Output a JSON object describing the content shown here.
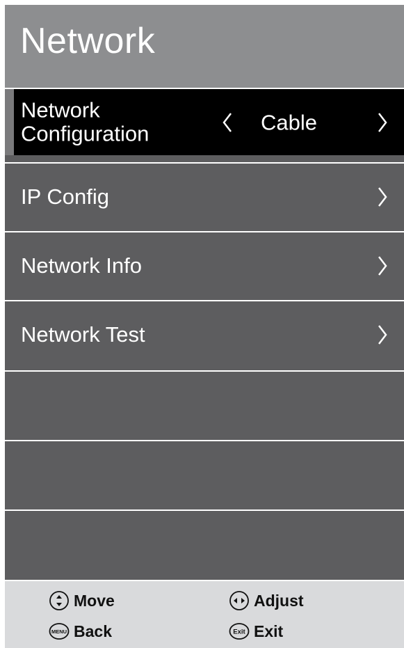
{
  "header": {
    "title": "Network"
  },
  "menu": {
    "items": [
      {
        "label": "Network Configuration",
        "value": "Cable",
        "selected": true
      },
      {
        "label": "IP Config"
      },
      {
        "label": "Network Info"
      },
      {
        "label": "Network Test"
      }
    ]
  },
  "footer": {
    "move": "Move",
    "adjust": "Adjust",
    "back": "Back",
    "exit": "Exit",
    "menu_icon_text": "MENU",
    "exit_icon_text": "Exit"
  },
  "colors": {
    "panel": "#5d5d5f",
    "header": "#8d8e90",
    "selected_row": "#000000",
    "footer": "#d9dadc"
  },
  "icons": [
    "chevron-left-icon",
    "chevron-right-icon",
    "up-down-icon",
    "left-right-icon",
    "menu-icon",
    "exit-icon"
  ]
}
